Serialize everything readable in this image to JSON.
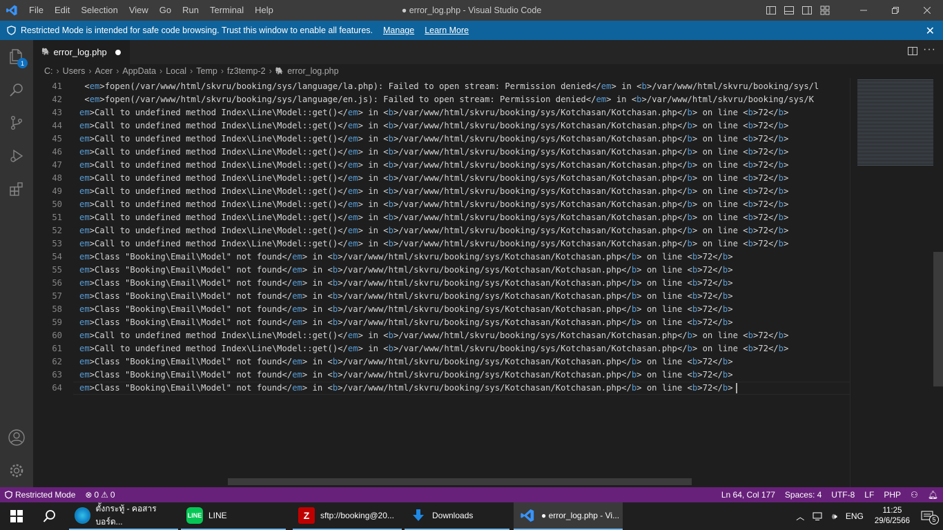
{
  "titlebar": {
    "menu": [
      "File",
      "Edit",
      "Selection",
      "View",
      "Go",
      "Run",
      "Terminal",
      "Help"
    ],
    "title": "● error_log.php - Visual Studio Code"
  },
  "banner": {
    "text": "Restricted Mode is intended for safe code browsing. Trust this window to enable all features.",
    "manage": "Manage",
    "learn_more": "Learn More"
  },
  "activity": {
    "explorer_badge": "1"
  },
  "tab": {
    "label": "error_log.php"
  },
  "breadcrumb": [
    "C:",
    "Users",
    "Acer",
    "AppData",
    "Local",
    "Temp",
    "fz3temp-2",
    "error_log.php"
  ],
  "editor": {
    "lines": [
      {
        "n": "41",
        "a": " <",
        "b": "em",
        "c": ">fopen(/var/www/html/skvru/booking/sys/language/la.php): Failed to open stream: Permission denied</",
        "d": "em",
        "e": "> in <",
        "f": "b",
        "g": ">/var/www/html/skvru/booking/sys/l",
        "h": "",
        "i": "",
        "j": "",
        "k": "",
        "l": ""
      },
      {
        "n": "42",
        "a": " <",
        "b": "em",
        "c": ">fopen(/var/www/html/skvru/booking/sys/language/en.js): Failed to open stream: Permission denied</",
        "d": "em",
        "e": "> in <",
        "f": "b",
        "g": ">/var/www/html/skvru/booking/sys/K",
        "h": "",
        "i": "",
        "j": "",
        "k": "",
        "l": ""
      },
      {
        "n": "43",
        "a": "",
        "b": "em",
        "c": ">Call to undefined method Index\\Line\\Model::get()</",
        "d": "em",
        "e": "> in <",
        "f": "b",
        "g": ">/var/www/html/skvru/booking/sys/Kotchasan/Kotchasan.php</",
        "h": "b",
        "i": "> on line <",
        "j": "b",
        "k": ">72</",
        "l": "b"
      },
      {
        "n": "44",
        "a": "",
        "b": "em",
        "c": ">Call to undefined method Index\\Line\\Model::get()</",
        "d": "em",
        "e": "> in <",
        "f": "b",
        "g": ">/var/www/html/skvru/booking/sys/Kotchasan/Kotchasan.php</",
        "h": "b",
        "i": "> on line <",
        "j": "b",
        "k": ">72</",
        "l": "b"
      },
      {
        "n": "45",
        "a": "",
        "b": "em",
        "c": ">Call to undefined method Index\\Line\\Model::get()</",
        "d": "em",
        "e": "> in <",
        "f": "b",
        "g": ">/var/www/html/skvru/booking/sys/Kotchasan/Kotchasan.php</",
        "h": "b",
        "i": "> on line <",
        "j": "b",
        "k": ">72</",
        "l": "b"
      },
      {
        "n": "46",
        "a": "",
        "b": "em",
        "c": ">Call to undefined method Index\\Line\\Model::get()</",
        "d": "em",
        "e": "> in <",
        "f": "b",
        "g": ">/var/www/html/skvru/booking/sys/Kotchasan/Kotchasan.php</",
        "h": "b",
        "i": "> on line <",
        "j": "b",
        "k": ">72</",
        "l": "b"
      },
      {
        "n": "47",
        "a": "",
        "b": "em",
        "c": ">Call to undefined method Index\\Line\\Model::get()</",
        "d": "em",
        "e": "> in <",
        "f": "b",
        "g": ">/var/www/html/skvru/booking/sys/Kotchasan/Kotchasan.php</",
        "h": "b",
        "i": "> on line <",
        "j": "b",
        "k": ">72</",
        "l": "b"
      },
      {
        "n": "48",
        "a": "",
        "b": "em",
        "c": ">Call to undefined method Index\\Line\\Model::get()</",
        "d": "em",
        "e": "> in <",
        "f": "b",
        "g": ">/var/www/html/skvru/booking/sys/Kotchasan/Kotchasan.php</",
        "h": "b",
        "i": "> on line <",
        "j": "b",
        "k": ">72</",
        "l": "b"
      },
      {
        "n": "49",
        "a": "",
        "b": "em",
        "c": ">Call to undefined method Index\\Line\\Model::get()</",
        "d": "em",
        "e": "> in <",
        "f": "b",
        "g": ">/var/www/html/skvru/booking/sys/Kotchasan/Kotchasan.php</",
        "h": "b",
        "i": "> on line <",
        "j": "b",
        "k": ">72</",
        "l": "b"
      },
      {
        "n": "50",
        "a": "",
        "b": "em",
        "c": ">Call to undefined method Index\\Line\\Model::get()</",
        "d": "em",
        "e": "> in <",
        "f": "b",
        "g": ">/var/www/html/skvru/booking/sys/Kotchasan/Kotchasan.php</",
        "h": "b",
        "i": "> on line <",
        "j": "b",
        "k": ">72</",
        "l": "b"
      },
      {
        "n": "51",
        "a": "",
        "b": "em",
        "c": ">Call to undefined method Index\\Line\\Model::get()</",
        "d": "em",
        "e": "> in <",
        "f": "b",
        "g": ">/var/www/html/skvru/booking/sys/Kotchasan/Kotchasan.php</",
        "h": "b",
        "i": "> on line <",
        "j": "b",
        "k": ">72</",
        "l": "b"
      },
      {
        "n": "52",
        "a": "",
        "b": "em",
        "c": ">Call to undefined method Index\\Line\\Model::get()</",
        "d": "em",
        "e": "> in <",
        "f": "b",
        "g": ">/var/www/html/skvru/booking/sys/Kotchasan/Kotchasan.php</",
        "h": "b",
        "i": "> on line <",
        "j": "b",
        "k": ">72</",
        "l": "b"
      },
      {
        "n": "53",
        "a": "",
        "b": "em",
        "c": ">Call to undefined method Index\\Line\\Model::get()</",
        "d": "em",
        "e": "> in <",
        "f": "b",
        "g": ">/var/www/html/skvru/booking/sys/Kotchasan/Kotchasan.php</",
        "h": "b",
        "i": "> on line <",
        "j": "b",
        "k": ">72</",
        "l": "b"
      },
      {
        "n": "54",
        "a": "",
        "b": "em",
        "c": ">Class \"Booking\\Email\\Model\" not found</",
        "d": "em",
        "e": "> in <",
        "f": "b",
        "g": ">/var/www/html/skvru/booking/sys/Kotchasan/Kotchasan.php</",
        "h": "b",
        "i": "> on line <",
        "j": "b",
        "k": ">72</",
        "l": "b"
      },
      {
        "n": "55",
        "a": "",
        "b": "em",
        "c": ">Class \"Booking\\Email\\Model\" not found</",
        "d": "em",
        "e": "> in <",
        "f": "b",
        "g": ">/var/www/html/skvru/booking/sys/Kotchasan/Kotchasan.php</",
        "h": "b",
        "i": "> on line <",
        "j": "b",
        "k": ">72</",
        "l": "b"
      },
      {
        "n": "56",
        "a": "",
        "b": "em",
        "c": ">Class \"Booking\\Email\\Model\" not found</",
        "d": "em",
        "e": "> in <",
        "f": "b",
        "g": ">/var/www/html/skvru/booking/sys/Kotchasan/Kotchasan.php</",
        "h": "b",
        "i": "> on line <",
        "j": "b",
        "k": ">72</",
        "l": "b"
      },
      {
        "n": "57",
        "a": "",
        "b": "em",
        "c": ">Class \"Booking\\Email\\Model\" not found</",
        "d": "em",
        "e": "> in <",
        "f": "b",
        "g": ">/var/www/html/skvru/booking/sys/Kotchasan/Kotchasan.php</",
        "h": "b",
        "i": "> on line <",
        "j": "b",
        "k": ">72</",
        "l": "b"
      },
      {
        "n": "58",
        "a": "",
        "b": "em",
        "c": ">Class \"Booking\\Email\\Model\" not found</",
        "d": "em",
        "e": "> in <",
        "f": "b",
        "g": ">/var/www/html/skvru/booking/sys/Kotchasan/Kotchasan.php</",
        "h": "b",
        "i": "> on line <",
        "j": "b",
        "k": ">72</",
        "l": "b"
      },
      {
        "n": "59",
        "a": "",
        "b": "em",
        "c": ">Class \"Booking\\Email\\Model\" not found</",
        "d": "em",
        "e": "> in <",
        "f": "b",
        "g": ">/var/www/html/skvru/booking/sys/Kotchasan/Kotchasan.php</",
        "h": "b",
        "i": "> on line <",
        "j": "b",
        "k": ">72</",
        "l": "b"
      },
      {
        "n": "60",
        "a": "",
        "b": "em",
        "c": ">Call to undefined method Index\\Line\\Model::get()</",
        "d": "em",
        "e": "> in <",
        "f": "b",
        "g": ">/var/www/html/skvru/booking/sys/Kotchasan/Kotchasan.php</",
        "h": "b",
        "i": "> on line <",
        "j": "b",
        "k": ">72</",
        "l": "b"
      },
      {
        "n": "61",
        "a": "",
        "b": "em",
        "c": ">Call to undefined method Index\\Line\\Model::get()</",
        "d": "em",
        "e": "> in <",
        "f": "b",
        "g": ">/var/www/html/skvru/booking/sys/Kotchasan/Kotchasan.php</",
        "h": "b",
        "i": "> on line <",
        "j": "b",
        "k": ">72</",
        "l": "b"
      },
      {
        "n": "62",
        "a": "",
        "b": "em",
        "c": ">Class \"Booking\\Email\\Model\" not found</",
        "d": "em",
        "e": "> in <",
        "f": "b",
        "g": ">/var/www/html/skvru/booking/sys/Kotchasan/Kotchasan.php</",
        "h": "b",
        "i": "> on line <",
        "j": "b",
        "k": ">72</",
        "l": "b"
      },
      {
        "n": "63",
        "a": "",
        "b": "em",
        "c": ">Class \"Booking\\Email\\Model\" not found</",
        "d": "em",
        "e": "> in <",
        "f": "b",
        "g": ">/var/www/html/skvru/booking/sys/Kotchasan/Kotchasan.php</",
        "h": "b",
        "i": "> on line <",
        "j": "b",
        "k": ">72</",
        "l": "b"
      },
      {
        "n": "64",
        "a": "",
        "b": "em",
        "c": ">Class \"Booking\\Email\\Model\" not found</",
        "d": "em",
        "e": "> in <",
        "f": "b",
        "g": ">/var/www/html/skvru/booking/sys/Kotchasan/Kotchasan.php</",
        "h": "b",
        "i": "> on line <",
        "j": "b",
        "k": ">72</",
        "l": "b"
      }
    ]
  },
  "statusbar": {
    "restricted": "Restricted Mode",
    "errors": "0",
    "warnings": "0",
    "position": "Ln 64, Col 177",
    "spaces": "Spaces: 4",
    "encoding": "UTF-8",
    "eol": "LF",
    "language": "PHP"
  },
  "taskbar": {
    "tasks": [
      "ตั้งกระทู้ - คอสารบอร์ด...",
      "LINE",
      "sftp://booking@20...",
      "Downloads",
      "● error_log.php - Vi..."
    ],
    "line_icon_text": "LINE",
    "lang": "ENG",
    "time": "11:25",
    "date": "29/6/2566",
    "notifications": "5"
  },
  "colors": {
    "accent": "#0e639c",
    "statusbar": "#68217a",
    "tag": "#569cd6"
  }
}
